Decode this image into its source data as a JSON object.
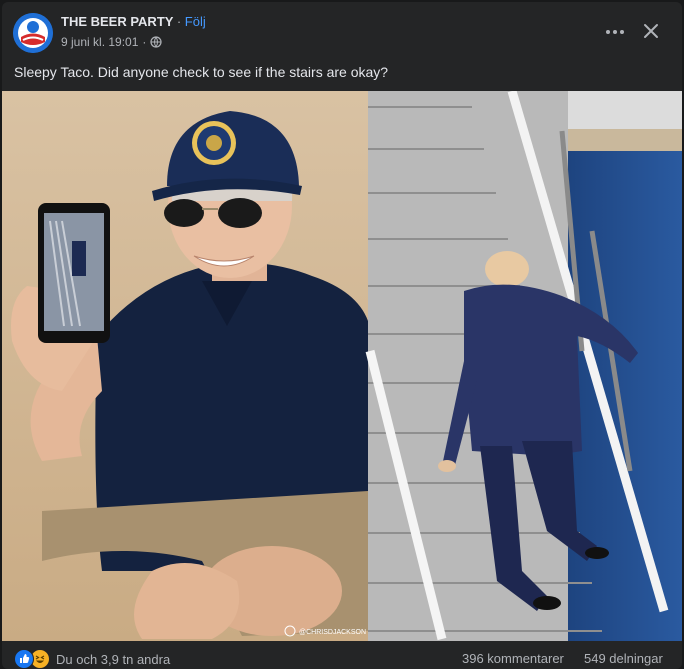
{
  "post": {
    "page_name": "THE BEER PARTY",
    "separator": "·",
    "follow_label": "Följ",
    "date": "9 juni kl. 19:01",
    "date_separator": "·",
    "text": "Sleepy Taco. Did anyone check to see if the stairs are okay?",
    "watermark": "@CHRISDJACKSON"
  },
  "footer": {
    "reactions_label": "Du och 3,9 tn andra",
    "comments_label": "396 kommentarer",
    "shares_label": "549 delningar"
  },
  "icons": {
    "more": "more-icon",
    "close": "close-icon",
    "audience": "globe-icon",
    "like": "like-icon",
    "haha": "haha-icon"
  },
  "colors": {
    "background": "#242526",
    "text": "#e4e6eb",
    "secondary": "#b0b3b8",
    "link": "#4599ff",
    "like": "#1877f2",
    "haha": "#f7b125"
  }
}
